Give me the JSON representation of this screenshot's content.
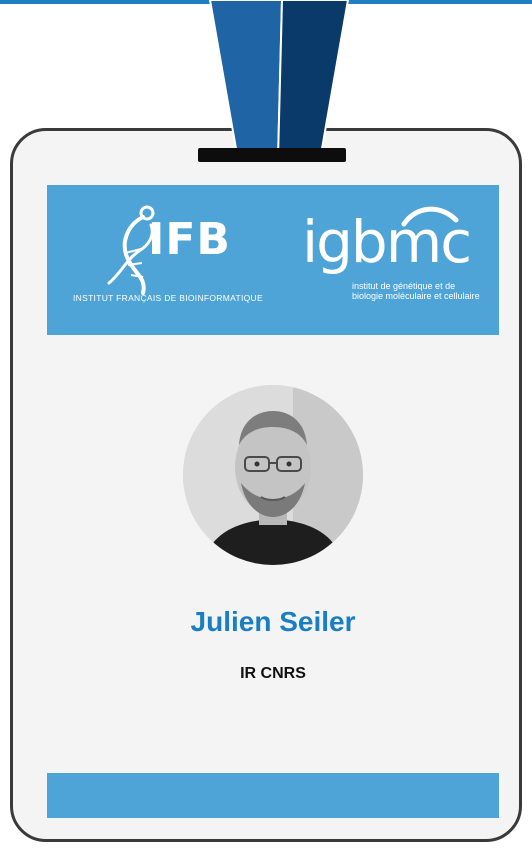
{
  "badge": {
    "name": "Julien Seiler",
    "title": "IR CNRS"
  },
  "logos": {
    "ifb": {
      "text": "IFB",
      "subtitle": "INSTITUT FRANÇAIS DE BIOINFORMATIQUE"
    },
    "igbmc": {
      "text": "igbmc",
      "subtitle_line1": "institut de génétique et de",
      "subtitle_line2": "biologie moléculaire et cellulaire"
    }
  },
  "colors": {
    "lanyard_dark": "#0a3a6a",
    "lanyard_light": "#1f64a5",
    "band": "#4ea4d6",
    "name": "#1a7ec2",
    "card_border": "#3a3a3a",
    "card_fill": "#f4f4f4"
  },
  "icons": {
    "lanyard": "lanyard-strap-icon",
    "ifb": "ifb-dna-logo-icon",
    "igbmc": "igbmc-arc-logo-icon"
  }
}
